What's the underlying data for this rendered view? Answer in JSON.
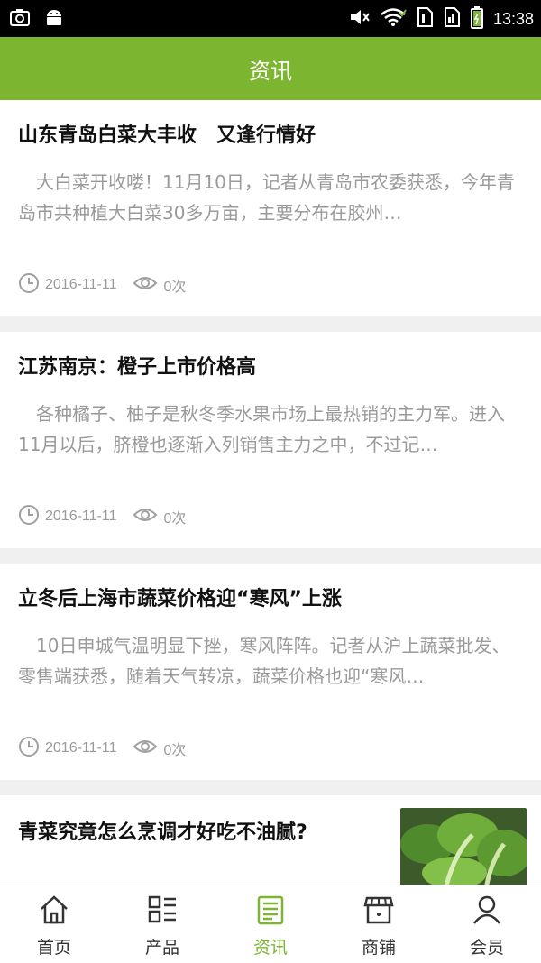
{
  "status_bar": {
    "time": "13:38"
  },
  "header": {
    "title": "资讯"
  },
  "articles": [
    {
      "title": "山东青岛白菜大丰收　又逢行情好",
      "summary": "　大白菜开收喽！11月10日，记者从青岛市农委获悉，今年青岛市共种植大白菜30多万亩，主要分布在胶州…",
      "date": "2016-11-11",
      "views": "0次"
    },
    {
      "title": "江苏南京：橙子上市价格高",
      "summary": "　各种橘子、柚子是秋冬季水果市场上最热销的主力军。进入11月以后，脐橙也逐渐入列销售主力之中，不过记…",
      "date": "2016-11-11",
      "views": "0次"
    },
    {
      "title": "立冬后上海市蔬菜价格迎“寒风”上涨",
      "summary": "　10日申城气温明显下挫，寒风阵阵。记者从沪上蔬菜批发、零售端获悉，随着天气转凉，蔬菜价格也迎“寒风…",
      "date": "2016-11-11",
      "views": "0次"
    },
    {
      "title": "青菜究竟怎么烹调才好吃不油腻?"
    }
  ],
  "tabs": [
    {
      "label": "首页",
      "icon": "home-icon"
    },
    {
      "label": "产品",
      "icon": "list-icon"
    },
    {
      "label": "资讯",
      "icon": "news-icon",
      "active": true
    },
    {
      "label": "商铺",
      "icon": "shop-icon"
    },
    {
      "label": "会员",
      "icon": "user-icon"
    }
  ],
  "colors": {
    "accent": "#7cb631",
    "meta_text": "#9a9a9a",
    "background": "#f0f0f0"
  }
}
